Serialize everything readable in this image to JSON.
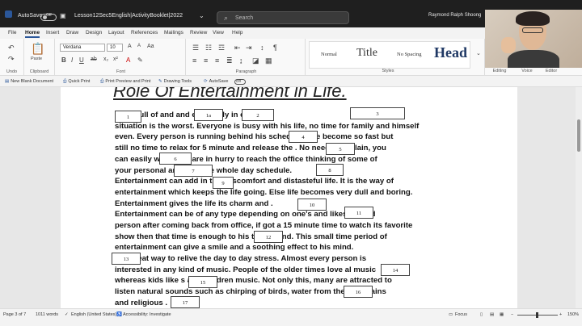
{
  "titlebar": {
    "autosave_label": "AutoSave",
    "autosave_state": "Off",
    "doc_name": "Lesson12Sec5English|ActivityBooklet|2022",
    "search_placeholder": "Search",
    "user_name": "Raymond Ralph Shoong"
  },
  "menu": {
    "tabs": [
      "File",
      "Home",
      "Insert",
      "Draw",
      "Design",
      "Layout",
      "References",
      "Mailings",
      "Review",
      "View",
      "Help"
    ],
    "active": "Home"
  },
  "ribbon": {
    "undo_label": "Undo",
    "clipboard_label": "Clipboard",
    "paste_label": "Paste",
    "font_label": "Font",
    "font_name": "Verdana",
    "font_size": "10",
    "paragraph_label": "Paragraph",
    "styles_label": "Styles",
    "editing_label": "Editing",
    "voice_label": "Voice",
    "editor_label": "Editor",
    "styles": [
      "Normal",
      "Title",
      "No Spacing",
      "Head"
    ]
  },
  "quickbar": {
    "items": [
      "New Blank Document",
      "Quick Print",
      "Print Preview and Print",
      "Drawing Tools",
      "AutoSave"
    ],
    "autosave_state": "Off"
  },
  "document": {
    "title": "Role Of Entertainment in Life.",
    "lines": [
      "life is full of           and           and especially in                    cities",
      "situation is the worst. Everyone is busy with his life, no time for family and himself",
      "even. Every person is running behind his           schedule. Life become so fast but",
      "still no time to relax for 5 minute and release the           . No need to explain, you",
      "can easily          when you are in hurry to reach the office thinking of some of",
      "your personal              and then the whole day           schedule.",
      "Entertainment can add        in this discomfort and distasteful life. It is the way of",
      "entertainment which keeps the life going. Else life becomes very dull and boring.",
      "Entertainment gives the life its charm and              .",
      "Entertainment can be of any type depending on one's           and likes. A tired",
      "person after coming back from office, if got a 15 minute time to watch its favorite",
      "show then that time is enough to        his tiring mind. This small time period of",
      "entertainment can give a smile and a soothing effect to his mind.",
      "          is a great way to relive the day to day stress. Almost every person is",
      "interested in any kind of music. People of the older times love            al music",
      "whereas kids like            s and children music. Not only this, many are attracted to",
      "listen natural sounds such as chirping of birds, water             from the mountains",
      "and religious           ."
    ],
    "blanks": [
      "1",
      "1a",
      "2",
      "3",
      "4",
      "5",
      "6",
      "7",
      "8",
      "9",
      "10",
      "11",
      "12",
      "13",
      "14",
      "15",
      "16",
      "17"
    ]
  },
  "statusbar": {
    "page": "Page 3 of 7",
    "words": "1011 words",
    "language": "English (United States)",
    "accessibility": "Accessibility: Investigate",
    "focus": "Focus",
    "zoom": "150%"
  }
}
